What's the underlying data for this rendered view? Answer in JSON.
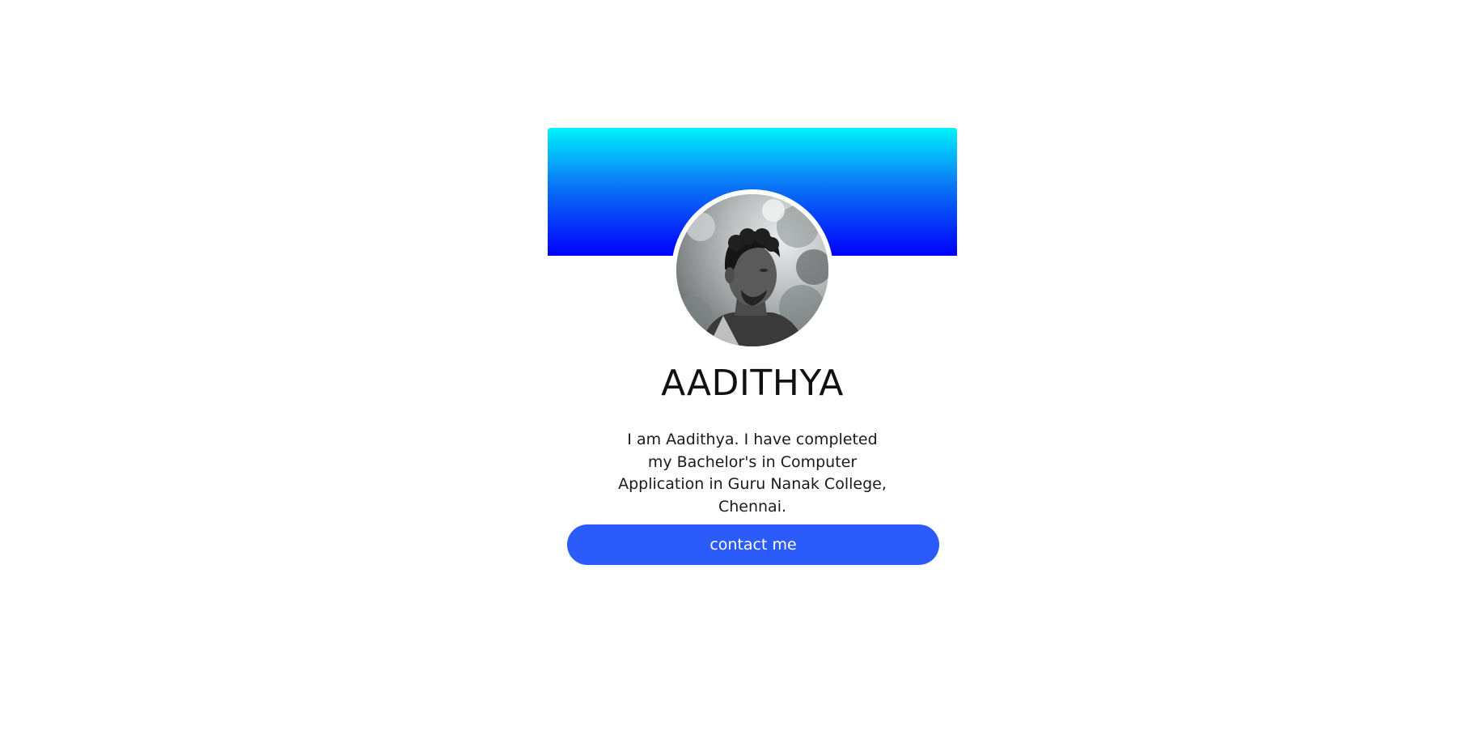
{
  "profile": {
    "name": "AADITHYA",
    "bio": "I am Aadithya. I have completed my Bachelor's in Computer Application in Guru Nanak College, Chennai.",
    "contact_label": "contact me"
  },
  "colors": {
    "banner_top": "#00f2fb",
    "banner_bottom": "#0000fa",
    "button": "#2b5cfb",
    "page_background": "#ffffff"
  }
}
